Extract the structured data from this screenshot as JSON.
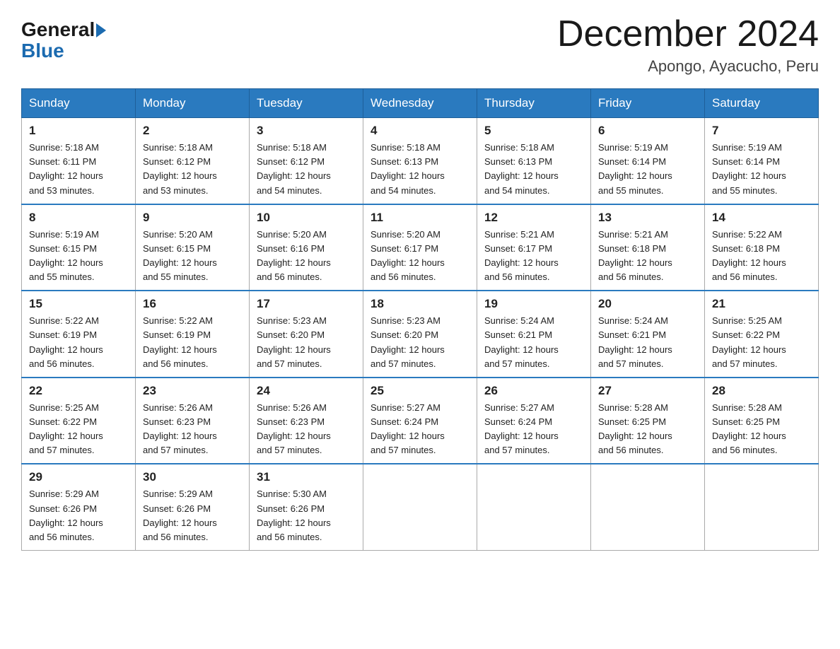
{
  "logo": {
    "general": "General",
    "blue": "Blue"
  },
  "title": "December 2024",
  "location": "Apongo, Ayacucho, Peru",
  "days_of_week": [
    "Sunday",
    "Monday",
    "Tuesday",
    "Wednesday",
    "Thursday",
    "Friday",
    "Saturday"
  ],
  "weeks": [
    [
      {
        "day": "1",
        "sunrise": "5:18 AM",
        "sunset": "6:11 PM",
        "daylight": "12 hours and 53 minutes."
      },
      {
        "day": "2",
        "sunrise": "5:18 AM",
        "sunset": "6:12 PM",
        "daylight": "12 hours and 53 minutes."
      },
      {
        "day": "3",
        "sunrise": "5:18 AM",
        "sunset": "6:12 PM",
        "daylight": "12 hours and 54 minutes."
      },
      {
        "day": "4",
        "sunrise": "5:18 AM",
        "sunset": "6:13 PM",
        "daylight": "12 hours and 54 minutes."
      },
      {
        "day": "5",
        "sunrise": "5:18 AM",
        "sunset": "6:13 PM",
        "daylight": "12 hours and 54 minutes."
      },
      {
        "day": "6",
        "sunrise": "5:19 AM",
        "sunset": "6:14 PM",
        "daylight": "12 hours and 55 minutes."
      },
      {
        "day": "7",
        "sunrise": "5:19 AM",
        "sunset": "6:14 PM",
        "daylight": "12 hours and 55 minutes."
      }
    ],
    [
      {
        "day": "8",
        "sunrise": "5:19 AM",
        "sunset": "6:15 PM",
        "daylight": "12 hours and 55 minutes."
      },
      {
        "day": "9",
        "sunrise": "5:20 AM",
        "sunset": "6:15 PM",
        "daylight": "12 hours and 55 minutes."
      },
      {
        "day": "10",
        "sunrise": "5:20 AM",
        "sunset": "6:16 PM",
        "daylight": "12 hours and 56 minutes."
      },
      {
        "day": "11",
        "sunrise": "5:20 AM",
        "sunset": "6:17 PM",
        "daylight": "12 hours and 56 minutes."
      },
      {
        "day": "12",
        "sunrise": "5:21 AM",
        "sunset": "6:17 PM",
        "daylight": "12 hours and 56 minutes."
      },
      {
        "day": "13",
        "sunrise": "5:21 AM",
        "sunset": "6:18 PM",
        "daylight": "12 hours and 56 minutes."
      },
      {
        "day": "14",
        "sunrise": "5:22 AM",
        "sunset": "6:18 PM",
        "daylight": "12 hours and 56 minutes."
      }
    ],
    [
      {
        "day": "15",
        "sunrise": "5:22 AM",
        "sunset": "6:19 PM",
        "daylight": "12 hours and 56 minutes."
      },
      {
        "day": "16",
        "sunrise": "5:22 AM",
        "sunset": "6:19 PM",
        "daylight": "12 hours and 56 minutes."
      },
      {
        "day": "17",
        "sunrise": "5:23 AM",
        "sunset": "6:20 PM",
        "daylight": "12 hours and 57 minutes."
      },
      {
        "day": "18",
        "sunrise": "5:23 AM",
        "sunset": "6:20 PM",
        "daylight": "12 hours and 57 minutes."
      },
      {
        "day": "19",
        "sunrise": "5:24 AM",
        "sunset": "6:21 PM",
        "daylight": "12 hours and 57 minutes."
      },
      {
        "day": "20",
        "sunrise": "5:24 AM",
        "sunset": "6:21 PM",
        "daylight": "12 hours and 57 minutes."
      },
      {
        "day": "21",
        "sunrise": "5:25 AM",
        "sunset": "6:22 PM",
        "daylight": "12 hours and 57 minutes."
      }
    ],
    [
      {
        "day": "22",
        "sunrise": "5:25 AM",
        "sunset": "6:22 PM",
        "daylight": "12 hours and 57 minutes."
      },
      {
        "day": "23",
        "sunrise": "5:26 AM",
        "sunset": "6:23 PM",
        "daylight": "12 hours and 57 minutes."
      },
      {
        "day": "24",
        "sunrise": "5:26 AM",
        "sunset": "6:23 PM",
        "daylight": "12 hours and 57 minutes."
      },
      {
        "day": "25",
        "sunrise": "5:27 AM",
        "sunset": "6:24 PM",
        "daylight": "12 hours and 57 minutes."
      },
      {
        "day": "26",
        "sunrise": "5:27 AM",
        "sunset": "6:24 PM",
        "daylight": "12 hours and 57 minutes."
      },
      {
        "day": "27",
        "sunrise": "5:28 AM",
        "sunset": "6:25 PM",
        "daylight": "12 hours and 56 minutes."
      },
      {
        "day": "28",
        "sunrise": "5:28 AM",
        "sunset": "6:25 PM",
        "daylight": "12 hours and 56 minutes."
      }
    ],
    [
      {
        "day": "29",
        "sunrise": "5:29 AM",
        "sunset": "6:26 PM",
        "daylight": "12 hours and 56 minutes."
      },
      {
        "day": "30",
        "sunrise": "5:29 AM",
        "sunset": "6:26 PM",
        "daylight": "12 hours and 56 minutes."
      },
      {
        "day": "31",
        "sunrise": "5:30 AM",
        "sunset": "6:26 PM",
        "daylight": "12 hours and 56 minutes."
      },
      null,
      null,
      null,
      null
    ]
  ],
  "labels": {
    "sunrise": "Sunrise:",
    "sunset": "Sunset:",
    "daylight": "Daylight:"
  }
}
